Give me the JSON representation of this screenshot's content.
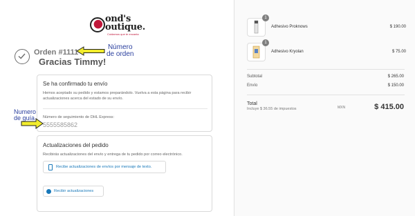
{
  "brand": {
    "logo_text": "ond's\noutique.",
    "tagline": "Cuidamos que te encanta"
  },
  "order": {
    "number": "Orden #1111",
    "thanks": "Gracias Timmy!"
  },
  "annotations": {
    "order_note": "Número\nde orden",
    "guia_note": "Numero\nde guía",
    "color": "#2a3f9e",
    "arrow_color": "#f2ec2c"
  },
  "shipping": {
    "heading": "Se ha confirmado tu envío",
    "message": "Hemos aceptado su pedido y estamos preparándolo. Vuelva a esta página para recibir actualizaciones acerca del estado de su envío.",
    "tracking_label": "Número de seguimiento de DHL Express:",
    "tracking_number": "5555585862"
  },
  "updates": {
    "heading": "Actualizaciones del pedido",
    "message": "Recibirás actualizaciones del envío y entrega de tu pedido por correo electrónico.",
    "sms_button": "Recibe actualizaciones de envíos por mensaje de texto.",
    "update_button": "Recibir actualizaciones"
  },
  "cart": {
    "items": [
      {
        "name": "Adhesivo Proknows",
        "price": "$ 190.00",
        "qty": "1"
      },
      {
        "name": "Adhesivo Kryolan",
        "price": "$ 75.00",
        "qty": "1"
      }
    ],
    "subtotal_label": "Subtotal",
    "subtotal": "$ 265.00",
    "shipping_label": "Envío",
    "shipping": "$ 150.00",
    "total_label": "Total",
    "tax_note": "Incluye $ 36.55 de impuestos",
    "currency": "MXN",
    "total": "$ 415.00"
  },
  "colors": {
    "link": "#1878b9",
    "brand_red": "#c0173a"
  }
}
